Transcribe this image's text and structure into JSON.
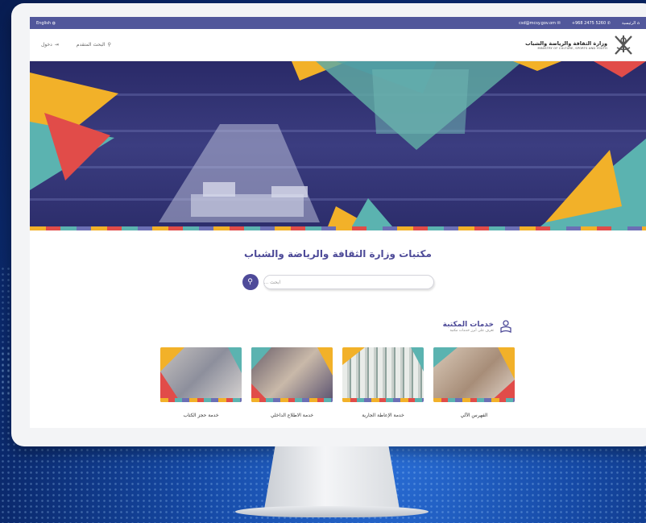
{
  "topbar": {
    "language": "English",
    "home": "الرئيسية",
    "phone": "+968 2475 5260",
    "email": "csd@mcsy.gov.om"
  },
  "header": {
    "logo_ar": "وزارة الثقافة والرياضة والشباب",
    "logo_en": "MINISTRY OF CULTURE, SPORTS AND YOUTH",
    "advanced_search": "البحث المتقدم",
    "login": "دخول"
  },
  "main": {
    "title": "مكتبات وزارة الثقافة والرياضة والشباب",
    "search_placeholder": "ابحث ..."
  },
  "services": {
    "title": "خدمات المكتبة",
    "subtitle": "تعرف على أبرز خدمات مكتبة",
    "cards": [
      {
        "label": "الفهرس الآلي"
      },
      {
        "label": "خدمة الإعاطة الجارية"
      },
      {
        "label": "خدمة الاطلاع الداخلي"
      },
      {
        "label": "خدمة حجز الكتاب"
      }
    ]
  },
  "colors": {
    "brand": "#51579b",
    "accent_yellow": "#f2b129",
    "accent_red": "#e14c49",
    "accent_teal": "#5bb3b0"
  },
  "icons": {
    "search": "search-icon",
    "login": "login-icon",
    "phone": "phone-icon",
    "email": "email-icon",
    "home": "home-icon",
    "globe": "globe-icon",
    "services": "person-reading-icon"
  }
}
